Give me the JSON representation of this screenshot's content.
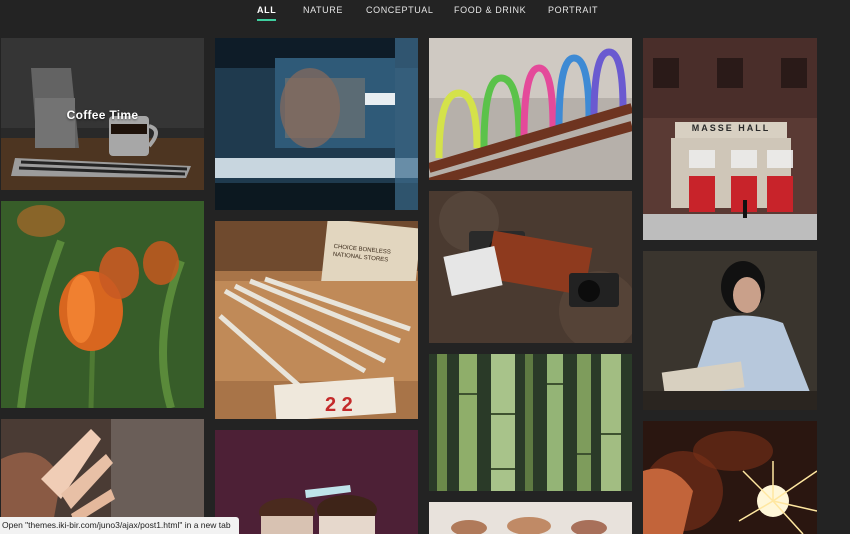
{
  "nav": {
    "items": [
      {
        "label": "ALL",
        "active": true
      },
      {
        "label": "NATURE"
      },
      {
        "label": "CONCEPTUAL"
      },
      {
        "label": "FOOD & DRINK"
      },
      {
        "label": "PORTRAIT"
      }
    ]
  },
  "gallery": {
    "coffee_caption": "Coffee Time",
    "hall_sign": "MASSE HALL",
    "crate_label_1": "CHOICE BONELESS",
    "crate_label_2": "NATIONAL STORES"
  },
  "status_bar": {
    "text": "Open \"themes.iki-bir.com/juno3/ajax/post1.html\" in a new tab"
  },
  "colors": {
    "background": "#232323",
    "accent": "#3fcf9f"
  }
}
